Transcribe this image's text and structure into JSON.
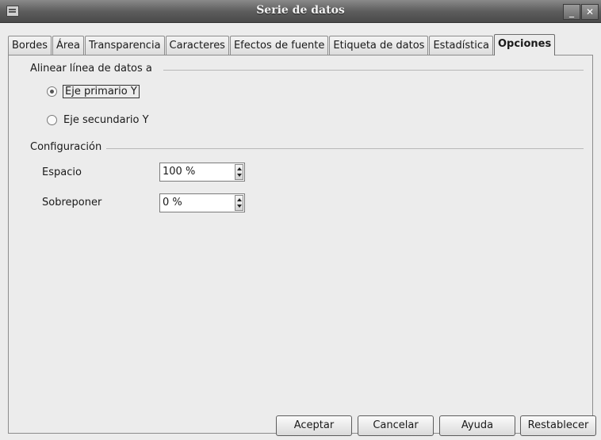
{
  "window": {
    "title": "Serie de datos",
    "minimize_icon": "minimize-icon",
    "close_icon": "close-icon"
  },
  "tabs": [
    {
      "label": "Bordes",
      "active": false
    },
    {
      "label": "Área",
      "active": false
    },
    {
      "label": "Transparencia",
      "active": false
    },
    {
      "label": "Caracteres",
      "active": false
    },
    {
      "label": "Efectos de fuente",
      "active": false
    },
    {
      "label": "Etiqueta de datos",
      "active": false
    },
    {
      "label": "Estadística",
      "active": false
    },
    {
      "label": "Opciones",
      "active": true
    }
  ],
  "align": {
    "section_label": "Alinear línea de datos a",
    "options": [
      {
        "label": "Eje primario Y",
        "checked": true
      },
      {
        "label": "Eje secundario Y",
        "checked": false
      }
    ]
  },
  "config": {
    "section_label": "Configuración",
    "fields": [
      {
        "label": "Espacio",
        "value": "100 %"
      },
      {
        "label": "Sobreponer",
        "value": "0 %"
      }
    ]
  },
  "buttons": {
    "ok": "Aceptar",
    "cancel": "Cancelar",
    "help": "Ayuda",
    "reset": "Restablecer"
  }
}
